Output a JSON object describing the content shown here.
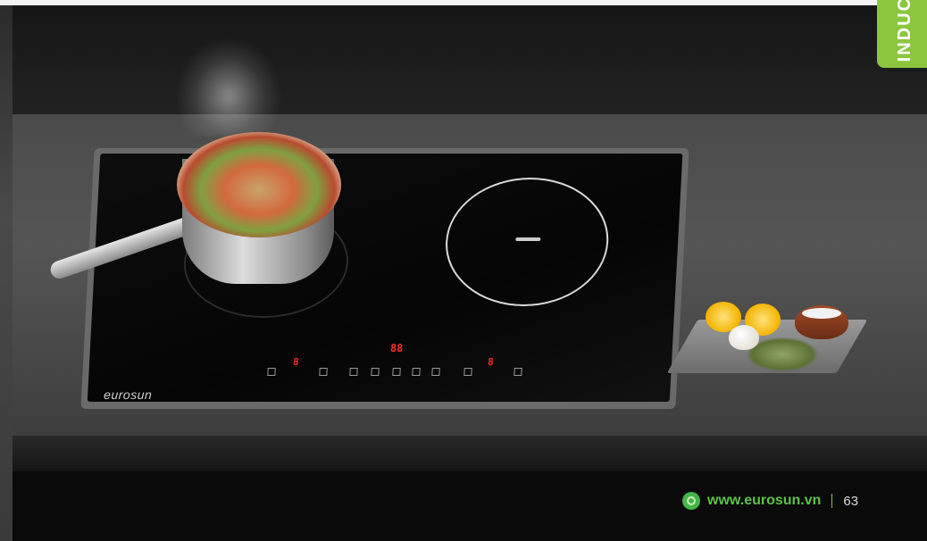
{
  "tab": {
    "label": "INDUC"
  },
  "cooktop": {
    "brand_logo": "eurosun",
    "left_zone_display": "8",
    "center_display": "88",
    "right_zone_display": "8"
  },
  "footer": {
    "website": "www.eurosun.vn",
    "page_number": "63"
  },
  "colors": {
    "accent_green": "#8cc63f",
    "display_red": "#ff2b2b"
  }
}
